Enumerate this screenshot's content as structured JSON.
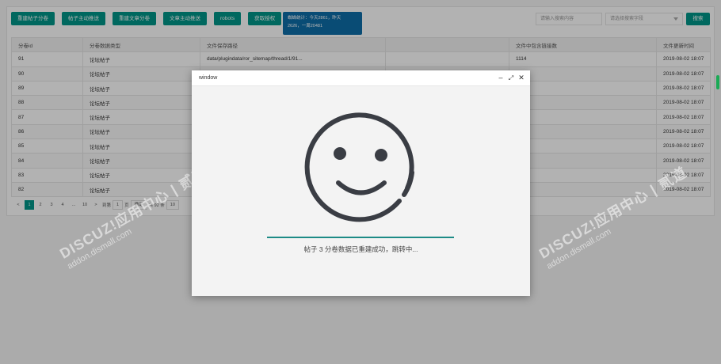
{
  "toolbar": {
    "buttons": [
      "重建帖子分卷",
      "帖子主动推送",
      "重建文章分卷",
      "文章主动推送",
      "robots",
      "获取授权"
    ]
  },
  "stats_tip": {
    "line1": "蜘蛛统计：今天2861，昨天",
    "line2": "2626，一周20481"
  },
  "search": {
    "input_placeholder": "请输入搜索内容",
    "select_placeholder": "请选择搜索字段",
    "button": "搜索"
  },
  "table": {
    "headers": [
      "分卷id",
      "分卷数据类型",
      "文件保存路径",
      "",
      "文件中包含链接数",
      "文件更新时间"
    ],
    "rows": [
      [
        "91",
        "论坛帖子",
        "data/plugindata/ror_sitemap/thread/1/91...",
        "",
        "1114",
        "2019-08-02 18:07"
      ],
      [
        "90",
        "论坛帖子",
        "",
        "",
        "",
        "2019-08-02 18:07"
      ],
      [
        "89",
        "论坛帖子",
        "",
        "",
        "",
        "2019-08-02 18:07"
      ],
      [
        "88",
        "论坛帖子",
        "",
        "",
        "",
        "2019-08-02 18:07"
      ],
      [
        "87",
        "论坛帖子",
        "",
        "",
        "",
        "2019-08-02 18:07"
      ],
      [
        "86",
        "论坛帖子",
        "",
        "",
        "",
        "2019-08-02 18:07"
      ],
      [
        "85",
        "论坛帖子",
        "",
        "",
        "",
        "2019-08-02 18:07"
      ],
      [
        "84",
        "论坛帖子",
        "",
        "",
        "",
        "2019-08-02 18:07"
      ],
      [
        "83",
        "论坛帖子",
        "",
        "",
        "",
        "2019-08-02 18:07"
      ],
      [
        "82",
        "论坛帖子",
        "",
        "",
        "",
        "2019-08-02 18:07"
      ]
    ]
  },
  "pager": {
    "prev": "<",
    "pages": [
      "1",
      "2",
      "3",
      "4",
      "...",
      "10"
    ],
    "next": ">",
    "goto_label": "到第",
    "goto_value": "1",
    "page_unit": "页",
    "confirm": "确定",
    "total": "共 92 条",
    "page_size": "10"
  },
  "watermark": {
    "main": "DISCUZ!应用中心 | 贰道",
    "sub": "addon.dismall.com"
  },
  "dialog": {
    "title": "window",
    "message": "帖子 3 分卷数据已重建成功，跳转中...",
    "progress": 1.0
  },
  "colors": {
    "primary": "#009688",
    "tip": "#0e6ea8",
    "progress": "#1d8b86",
    "smiley": "#3a3d44"
  }
}
